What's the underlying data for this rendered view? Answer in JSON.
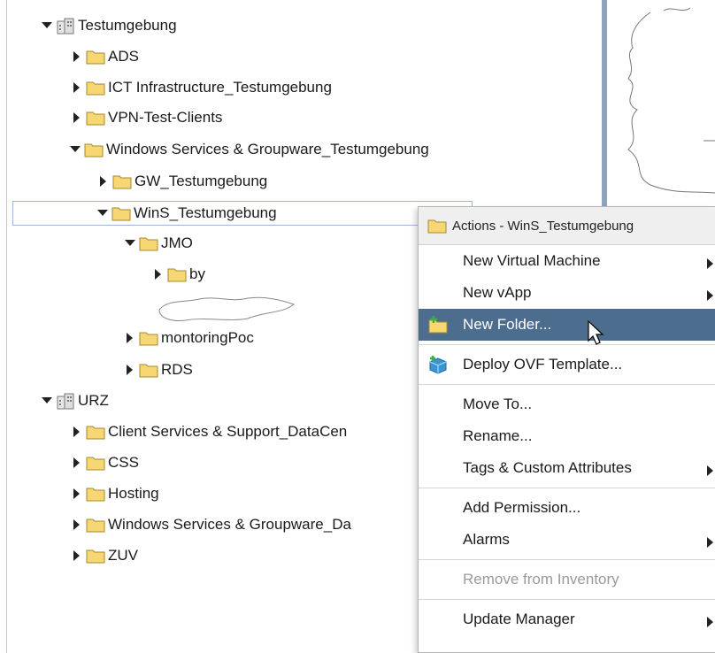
{
  "tree": {
    "items": [
      {
        "label": "Testumgebung",
        "icon": "datacenter-icon",
        "expanded": true
      },
      {
        "label": "ADS",
        "icon": "folder-icon",
        "expanded": false
      },
      {
        "label": "ICT Infrastructure_Testumgebung",
        "icon": "folder-icon",
        "expanded": false
      },
      {
        "label": "VPN-Test-Clients",
        "icon": "folder-icon",
        "expanded": false
      },
      {
        "label": "Windows Services & Groupware_Testumgebung",
        "icon": "folder-icon",
        "expanded": true
      },
      {
        "label": "GW_Testumgebung",
        "icon": "folder-icon",
        "expanded": false
      },
      {
        "label": "WinS_Testumgebung",
        "icon": "folder-icon",
        "expanded": true,
        "selected": true
      },
      {
        "label": "JMO",
        "icon": "folder-icon",
        "expanded": true
      },
      {
        "label": "by",
        "icon": "folder-icon",
        "expanded": false
      },
      {
        "label": "montoringPoc",
        "icon": "folder-icon",
        "expanded": false
      },
      {
        "label": "RDS",
        "icon": "folder-icon",
        "expanded": false
      },
      {
        "label": "URZ",
        "icon": "datacenter-icon",
        "expanded": true
      },
      {
        "label": "Client Services & Support_DataCen",
        "icon": "folder-icon",
        "expanded": false
      },
      {
        "label": "CSS",
        "icon": "folder-icon",
        "expanded": false
      },
      {
        "label": "Hosting",
        "icon": "folder-icon",
        "expanded": false
      },
      {
        "label": "Windows Services & Groupware_Da",
        "icon": "folder-icon",
        "expanded": false
      },
      {
        "label": "ZUV",
        "icon": "folder-icon",
        "expanded": false
      }
    ]
  },
  "context_menu": {
    "title": "Actions - WinS_Testumgebung",
    "items": {
      "new_vm": "New Virtual Machine",
      "new_vapp": "New vApp",
      "new_folder": "New Folder...",
      "deploy_ovf": "Deploy OVF Template...",
      "move_to": "Move To...",
      "rename": "Rename...",
      "tags": "Tags & Custom Attributes",
      "add_permission": "Add Permission...",
      "alarms": "Alarms",
      "remove": "Remove from Inventory",
      "update_manager": "Update Manager"
    },
    "highlight_color": "#4d6d8f"
  },
  "colors": {
    "folder_fill": "#f7d774",
    "folder_stroke": "#a58a2e",
    "splitter": "#8fa3bf"
  }
}
